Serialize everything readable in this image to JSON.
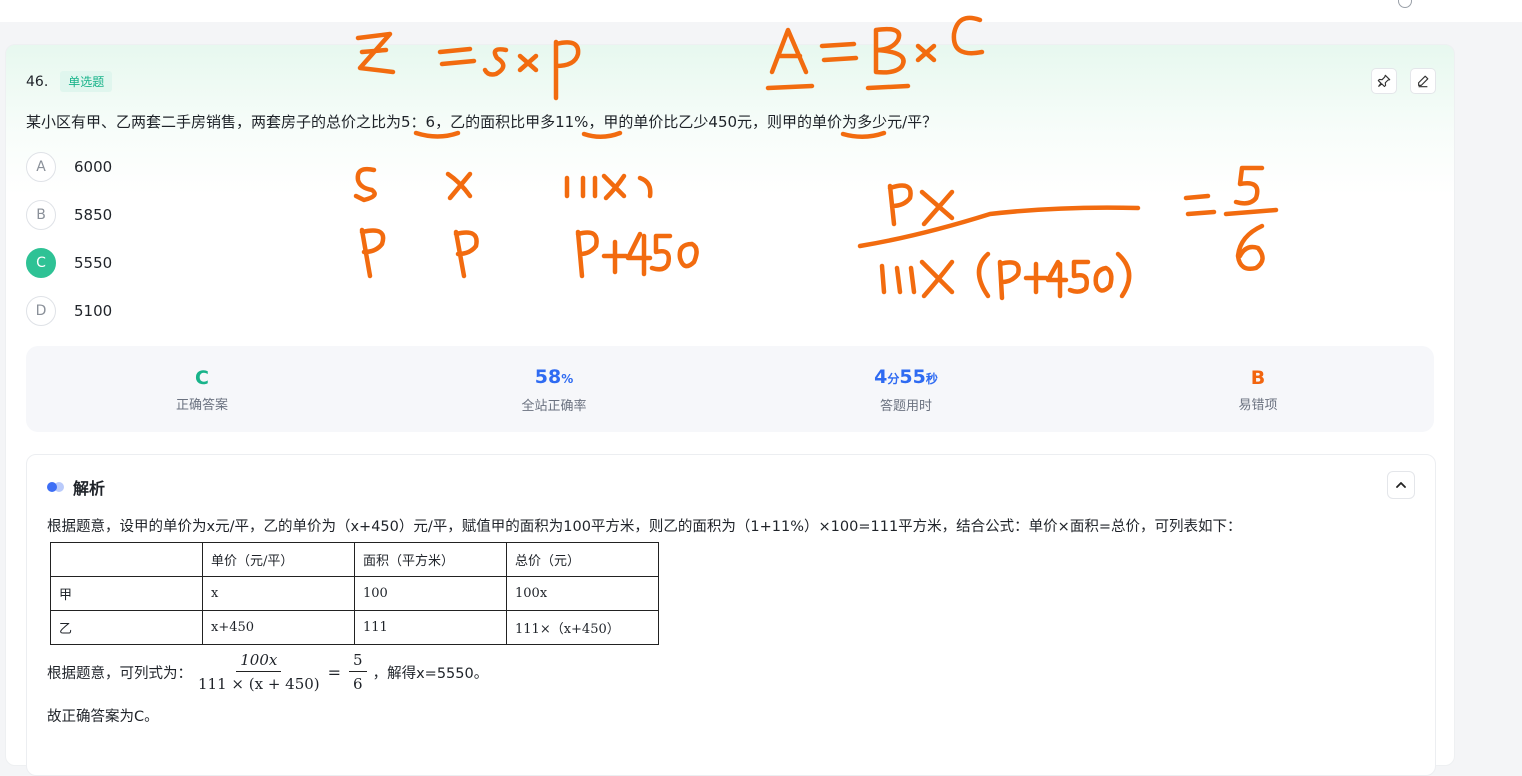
{
  "question": {
    "number": "46.",
    "type": "单选题",
    "stem": "某小区有甲、乙两套二手房销售，两套房子的总价之比为5：6，乙的面积比甲多11%，甲的单价比乙少450元，则甲的单价为多少元/平？",
    "options": [
      {
        "letter": "A",
        "text": "6000",
        "selected": false
      },
      {
        "letter": "B",
        "text": "5850",
        "selected": false
      },
      {
        "letter": "C",
        "text": "5550",
        "selected": true
      },
      {
        "letter": "D",
        "text": "5100",
        "selected": false
      }
    ]
  },
  "stats": {
    "correct_answer": {
      "value": "C",
      "label": "正确答案"
    },
    "accuracy": {
      "value": "58",
      "unit": "%",
      "label": "全站正确率"
    },
    "time": {
      "min": "4",
      "min_unit": "分",
      "sec": "55",
      "sec_unit": "秒",
      "label": "答题用时"
    },
    "common_wrong": {
      "value": "B",
      "label": "易错项"
    }
  },
  "analysis": {
    "title": "解析",
    "para1": "根据题意，设甲的单价为x元/平，乙的单价为（x+450）元/平，赋值甲的面积为100平方米，则乙的面积为（1+11%）×100=111平方米，结合公式：单价×面积=总价，可列表如下：",
    "table": {
      "header": [
        "",
        "单价（元/平）",
        "面积（平方米）",
        "总价（元）"
      ],
      "rows": [
        [
          "甲",
          "x",
          "100",
          "100x"
        ],
        [
          "乙",
          "x+450",
          "111",
          "111×（x+450）"
        ]
      ]
    },
    "formula_prefix": "根据题意，可列式为：",
    "formula_num": "100x",
    "formula_den": "111 × (x + 450)",
    "formula_eq": "=",
    "formula_rhs_num": "5",
    "formula_rhs_den": "6",
    "formula_suffix": "，解得x=5550。",
    "conclusion": "故正确答案为C。"
  },
  "colors": {
    "accent_green": "#2ec295",
    "blue": "#2f6bf2",
    "orange": "#f2650f",
    "ink": "#f26b0f"
  },
  "icons": [
    "pin-icon",
    "edit-icon",
    "chevron-up-icon",
    "analysis-dots-icon"
  ]
}
